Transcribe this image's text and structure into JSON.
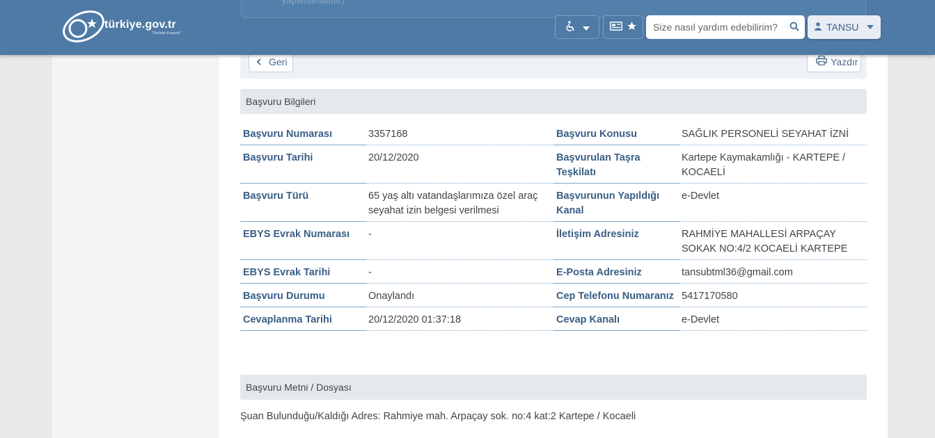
{
  "header": {
    "logo_text": "türkiye.gov.tr",
    "logo_subtitle": "\"Devletin Kısayolu\"",
    "hidden_card_text": "yapılmamalıdır)",
    "search_placeholder": "Size nasıl yardım edebilirim?",
    "user_name": "TANSU",
    "brand_color": "#4e7aa5"
  },
  "toolbar": {
    "back_label": "Geri",
    "print_label": "Yazdır"
  },
  "sections": {
    "info_title": "Başvuru Bilgileri",
    "text_title": "Başvuru Metni / Dosyası"
  },
  "rows": [
    {
      "l1": "Başvuru Numarası",
      "v1": "3357168",
      "l2": "Başvuru Konusu",
      "v2": "SAĞLIK PERSONELİ SEYAHAT İZNİ"
    },
    {
      "l1": "Başvuru Tarihi",
      "v1": "20/12/2020",
      "l2": "Başvurulan Taşra Teşkilatı",
      "v2": "Kartepe Kaymakamlığı - KARTEPE / KOCAELİ"
    },
    {
      "l1": "Başvuru Türü",
      "v1": "65 yaş altı vatandaşlarımıza özel araç seyahat izin belgesi verilmesi",
      "l2": "Başvurunun Yapıldığı Kanal",
      "v2": "e-Devlet"
    },
    {
      "l1": "EBYS Evrak Numarası",
      "v1": "-",
      "l2": "İletişim Adresiniz",
      "v2": "RAHMİYE MAHALLESİ ARPAÇAY SOKAK NO:4/2 KOCAELİ KARTEPE"
    },
    {
      "l1": "EBYS Evrak Tarihi",
      "v1": "-",
      "l2": "E-Posta Adresiniz",
      "v2": "tansubtml36@gmail.com"
    },
    {
      "l1": "Başvuru Durumu",
      "v1": "Onaylandı",
      "l2": "Cep Telefonu Numaranız",
      "v2": "5417170580"
    },
    {
      "l1": "Cevaplanma Tarihi",
      "v1": "20/12/2020 01:37:18",
      "l2": "Cevap Kanalı",
      "v2": "e-Devlet"
    }
  ],
  "application_text": "Şuan Bulunduğu/Kaldığı Adres: Rahmiye mah. Arpaçay sok. no:4 kat:2 Kartepe / Kocaeli"
}
